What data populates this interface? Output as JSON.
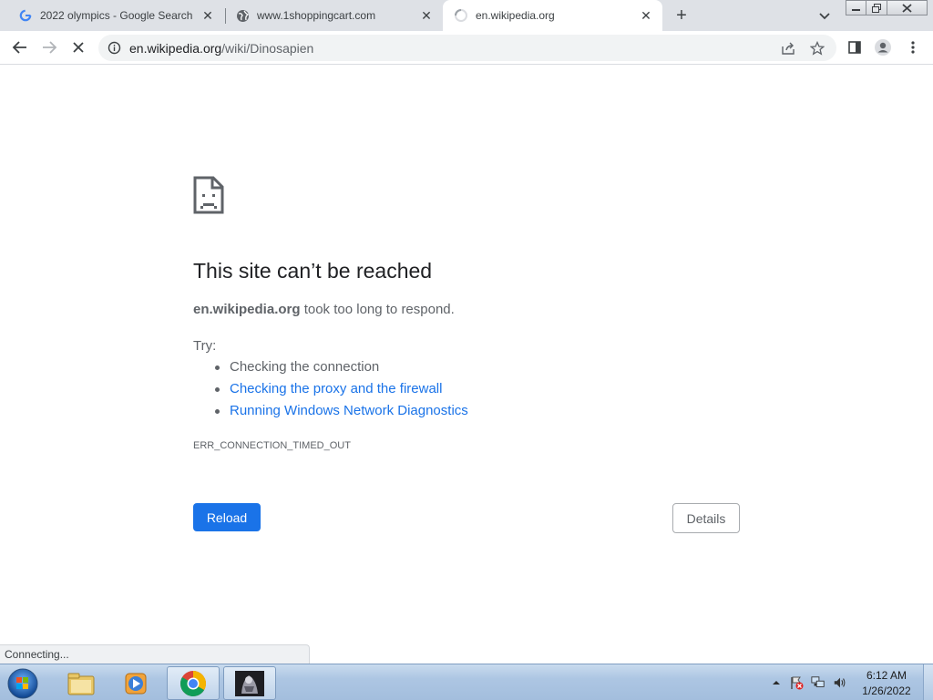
{
  "tabs": [
    {
      "title": "2022 olympics - Google Search",
      "favicon": "google-icon"
    },
    {
      "title": "www.1shoppingcart.com",
      "favicon": "globe-icon"
    },
    {
      "title": "en.wikipedia.org",
      "favicon": "loading-spinner-icon",
      "active": true
    }
  ],
  "toolbar": {
    "url_host": "en.wikipedia.org",
    "url_path": "/wiki/Dinosapien"
  },
  "error": {
    "title": "This site can’t be reached",
    "host": "en.wikipedia.org",
    "message": " took too long to respond.",
    "try_label": "Try:",
    "suggestions": [
      {
        "text": "Checking the connection",
        "link": false
      },
      {
        "text": "Checking the proxy and the firewall",
        "link": true
      },
      {
        "text": "Running Windows Network Diagnostics",
        "link": true
      }
    ],
    "code": "ERR_CONNECTION_TIMED_OUT",
    "reload_label": "Reload",
    "details_label": "Details"
  },
  "status": {
    "text": "Connecting..."
  },
  "taskbar": {
    "clock_time": "6:12 AM",
    "clock_date": "1/26/2022",
    "pinned": [
      "windows-explorer-icon",
      "media-player-icon",
      "chrome-icon",
      "image-thumbnail-icon"
    ]
  },
  "colors": {
    "accent": "#1a73e8",
    "tabstrip": "#dee1e6"
  }
}
